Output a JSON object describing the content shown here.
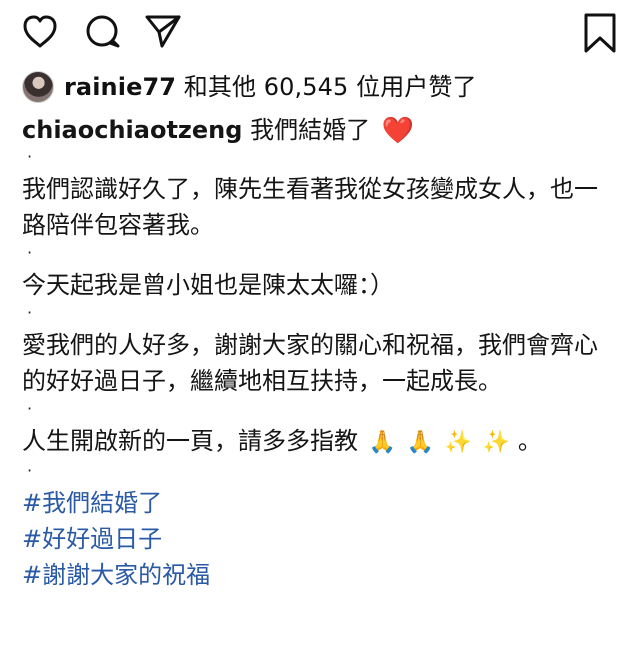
{
  "header_icons": {
    "like_icon": "heart-outline",
    "comment_icon": "speech-bubble",
    "share_icon": "paper-plane",
    "save_icon": "bookmark"
  },
  "likes": {
    "liked_by_user": "rainie77",
    "likes_suffix": " 和其他 60,545 位用户赞了"
  },
  "post": {
    "author": "chiaochiaotzeng",
    "title": "我們結婚了",
    "title_emoji": "❤️",
    "lines": [
      "我們認識好久了，陳先生看著我從女孩變成女人，也一路陪伴包容著我。",
      "今天起我是曾小姐也是陳太太囉：）",
      "愛我們的人好多，謝謝大家的關心和祝福，我們會齊心的好好過日子，繼續地相互扶持，一起成長。",
      "人生開啟新的一頁，請多多指教"
    ],
    "ending_emoji": [
      "🙏",
      "🙏",
      "✨",
      "✨"
    ],
    "ending_period": "。",
    "separator": "·"
  },
  "hashtags": [
    "#我們結婚了",
    "#好好過日子",
    "#謝謝大家的祝福"
  ]
}
